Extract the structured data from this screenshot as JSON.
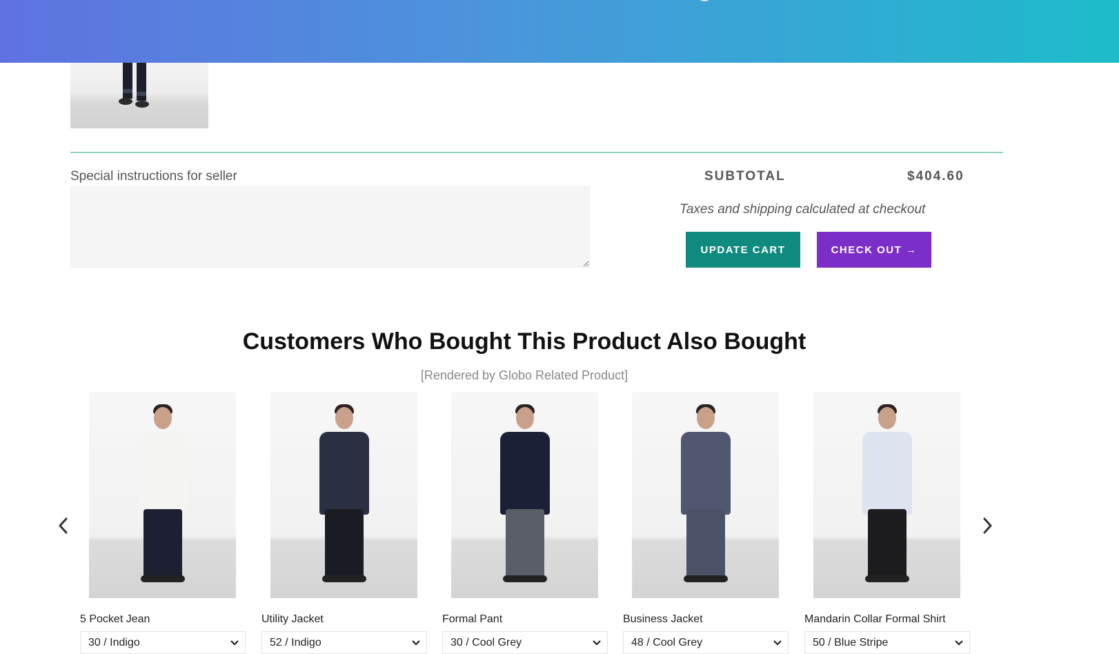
{
  "cart": {
    "notes_label": "Special instructions for seller",
    "notes_value": "",
    "subtotal_label": "SUBTOTAL",
    "subtotal_value": "$404.60",
    "tax_note": "Taxes and shipping calculated at checkout",
    "update_label": "UPDATE CART",
    "checkout_label": "CHECK OUT →"
  },
  "related": {
    "title": "Customers Who Bought This Product Also Bought",
    "subtitle": "[Rendered by Globo Related Product]",
    "prev_icon": "chevron-left-icon",
    "next_icon": "chevron-right-icon",
    "products": [
      {
        "name": "5 Pocket Jean",
        "variant": "30 / Indigo",
        "top_color": "#f4f4f2",
        "bottom_color": "#1d2030"
      },
      {
        "name": "Utility Jacket",
        "variant": "52 / Indigo",
        "top_color": "#2a3042",
        "bottom_color": "#1a1c24"
      },
      {
        "name": "Formal Pant",
        "variant": "30 / Cool Grey",
        "top_color": "#1b2036",
        "bottom_color": "#5a5e68"
      },
      {
        "name": "Business Jacket",
        "variant": "48 / Cool Grey",
        "top_color": "#4f5870",
        "bottom_color": "#4a5268"
      },
      {
        "name": "Mandarin Collar Formal Shirt",
        "variant": "50 / Blue Stripe",
        "top_color": "#dde4f0",
        "bottom_color": "#1c1c1f"
      }
    ]
  },
  "colors": {
    "header_gradient_start": "#5f72e0",
    "header_gradient_end": "#1dbccb",
    "update_button": "#0f8a7f",
    "checkout_button": "#7b2fc8",
    "divider": "#8fd3bf"
  }
}
